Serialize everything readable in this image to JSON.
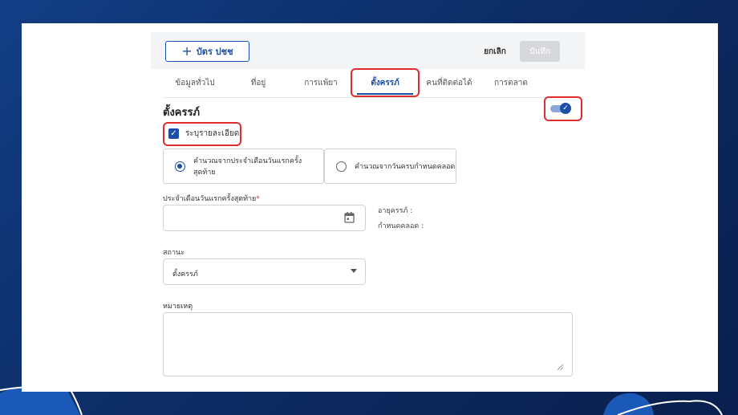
{
  "toolbar": {
    "add_label": "บัตร ปชช",
    "add_icon": "plus-icon",
    "cancel_label": "ยกเลิก",
    "save_label": "บันทึก"
  },
  "tabs": [
    {
      "label": "ข้อมูลทั่วไป",
      "active": false
    },
    {
      "label": "ที่อยู่",
      "active": false
    },
    {
      "label": "การแพ้ยา",
      "active": false
    },
    {
      "label": "ตั้งครรภ์",
      "active": true
    },
    {
      "label": "คนที่ติดต่อได้",
      "active": false
    },
    {
      "label": "การตลาด",
      "active": false
    }
  ],
  "section": {
    "title": "ตั้งครรภ์",
    "toggle_on": true
  },
  "detail_checkbox": {
    "label": "ระบุรายละเอียด",
    "checked": true
  },
  "calc_options": [
    {
      "label": "คำนวณจากประจำเดือนวันแรกครั้งสุดท้าย",
      "selected": true
    },
    {
      "label": "คำนวณจากวันครบกำหนดคลอด",
      "selected": false
    }
  ],
  "lmp_field": {
    "label": "ประจำเดือนวันแรกครั้งสุดท้าย",
    "required_mark": "*",
    "value": "",
    "icon": "calendar-icon"
  },
  "info": {
    "gestational_age_label": "อายุครรภ์ :",
    "due_date_label": "กำหนดคลอด :"
  },
  "status_field": {
    "label": "สถานะ",
    "value": "ตั้งครรภ์"
  },
  "note_field": {
    "label": "หมายเหตุ",
    "value": ""
  },
  "colors": {
    "primary": "#1e4fa8",
    "highlight": "#e02c2c",
    "background": "#0d2d66"
  }
}
